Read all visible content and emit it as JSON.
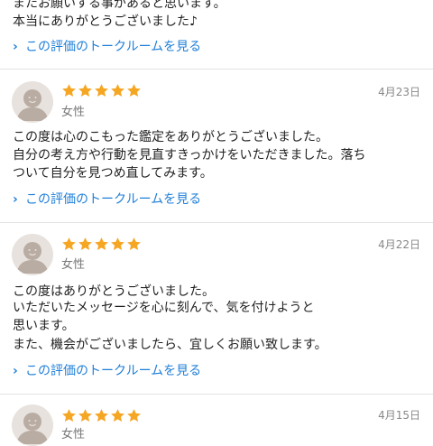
{
  "accent": "#1f7fd8",
  "star_color": "#f5a623",
  "link_label": "この評価のトークルームを見る",
  "chevron": "›",
  "top": {
    "lines": [
      "またお願いする事があると思います。",
      "本当にありがとうございました♪"
    ]
  },
  "reviews": [
    {
      "rating": 5,
      "gender": "女性",
      "date": "4月23日",
      "lines": [
        "この度は心のこもった鑑定をありがとうございました。",
        "自分の考え方や行動を見直すきっかけをいただきました。落ち",
        "ついて自分を見つめ直してみます。"
      ]
    },
    {
      "rating": 5,
      "gender": "女性",
      "date": "4月22日",
      "lines": [
        "この度はありがとうございました。",
        "いただいたメッセージを心に刻んで、気を付けようと",
        "思います。",
        "また、機会がございましたら、宜しくお願い致します。"
      ]
    },
    {
      "rating": 5,
      "gender": "女性",
      "date": "4月15日",
      "lines": []
    }
  ]
}
